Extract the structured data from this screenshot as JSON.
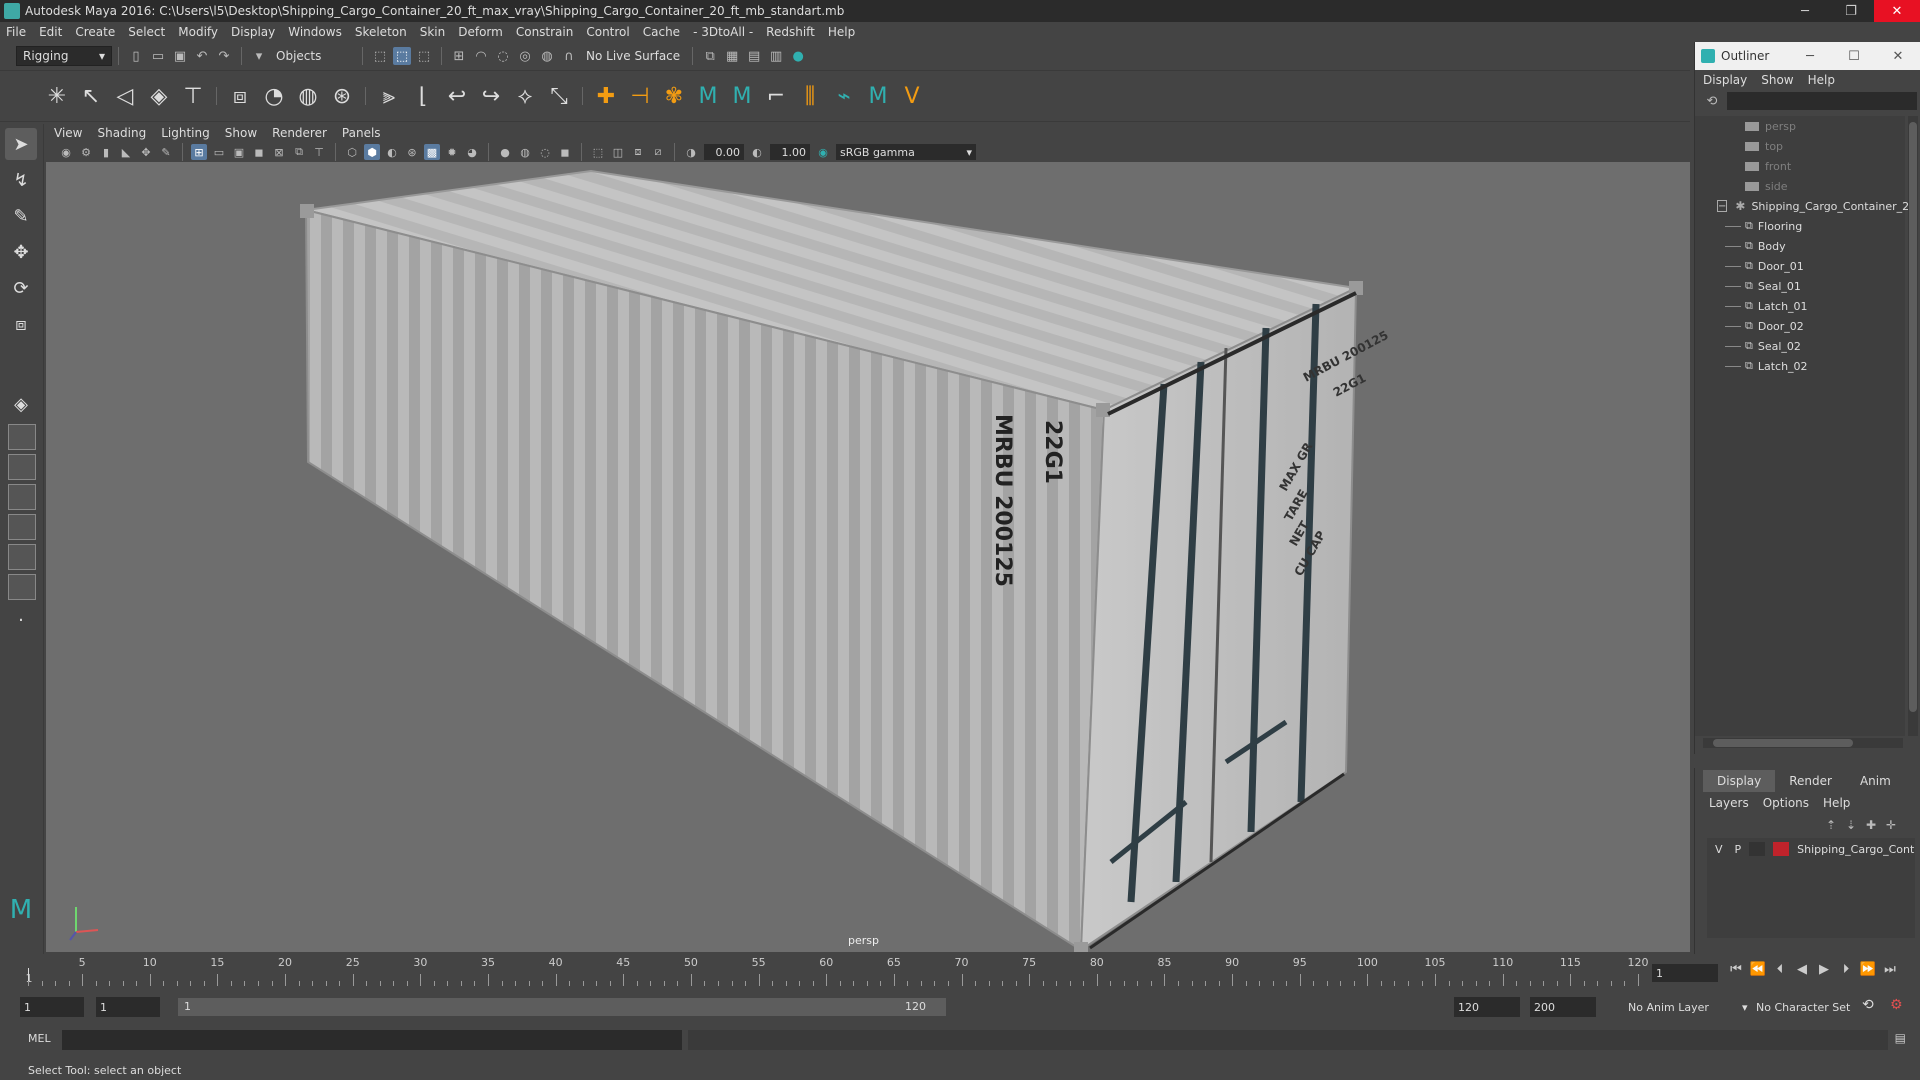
{
  "window": {
    "title": "Autodesk Maya 2016: C:\\Users\\l5\\Desktop\\Shipping_Cargo_Container_20_ft_max_vray\\Shipping_Cargo_Container_20_ft_mb_standart.mb"
  },
  "menubar": [
    "File",
    "Edit",
    "Create",
    "Select",
    "Modify",
    "Display",
    "Windows",
    "Skeleton",
    "Skin",
    "Deform",
    "Constrain",
    "Control",
    "Cache",
    "- 3DtoAll -",
    "Redshift",
    "Help"
  ],
  "statusline": {
    "menuset": "Rigging",
    "selection_mode": "Objects",
    "live_surface": "No Live Surface"
  },
  "viewport": {
    "menu": [
      "View",
      "Shading",
      "Lighting",
      "Show",
      "Renderer",
      "Panels"
    ],
    "exposure": "0.00",
    "gamma": "1.00",
    "color_space": "sRGB gamma",
    "camera": "persp",
    "container_text": {
      "side_id": "MRBU 200125",
      "side_type": "22G1",
      "door_id": "MRBU 200125",
      "door_type": "22G1",
      "door_plate": [
        "MAX GR",
        "TARE",
        "NET",
        "CU CAP"
      ]
    }
  },
  "outliner": {
    "title": "Outliner",
    "menu": [
      "Display",
      "Show",
      "Help"
    ],
    "cameras": [
      "persp",
      "top",
      "front",
      "side"
    ],
    "group": "Shipping_Cargo_Container_2",
    "children": [
      "Flooring",
      "Body",
      "Door_01",
      "Seal_01",
      "Latch_01",
      "Door_02",
      "Seal_02",
      "Latch_02"
    ]
  },
  "layers": {
    "tabs": [
      "Display",
      "Render",
      "Anim"
    ],
    "menu": [
      "Layers",
      "Options",
      "Help"
    ],
    "rows": [
      {
        "v": "V",
        "p": "P",
        "name": "Shipping_Cargo_Cont",
        "color": "#c0232b"
      }
    ]
  },
  "timeline": {
    "ticks": [
      "5",
      "10",
      "15",
      "20",
      "25",
      "30",
      "35",
      "40",
      "45",
      "50",
      "55",
      "60",
      "65",
      "70",
      "75",
      "80",
      "85",
      "90",
      "95",
      "100",
      "105",
      "110",
      "115",
      "120"
    ],
    "start_marker": "1",
    "current_frame": "1"
  },
  "range": {
    "start": "1",
    "playback_start": "1",
    "bar_start": "1",
    "bar_end": "120",
    "playback_end": "120",
    "end": "200",
    "anim_layer": "No Anim Layer",
    "character_set": "No Character Set"
  },
  "cmdline": {
    "label": "MEL"
  },
  "helpline": {
    "text": "Select Tool: select an object"
  }
}
